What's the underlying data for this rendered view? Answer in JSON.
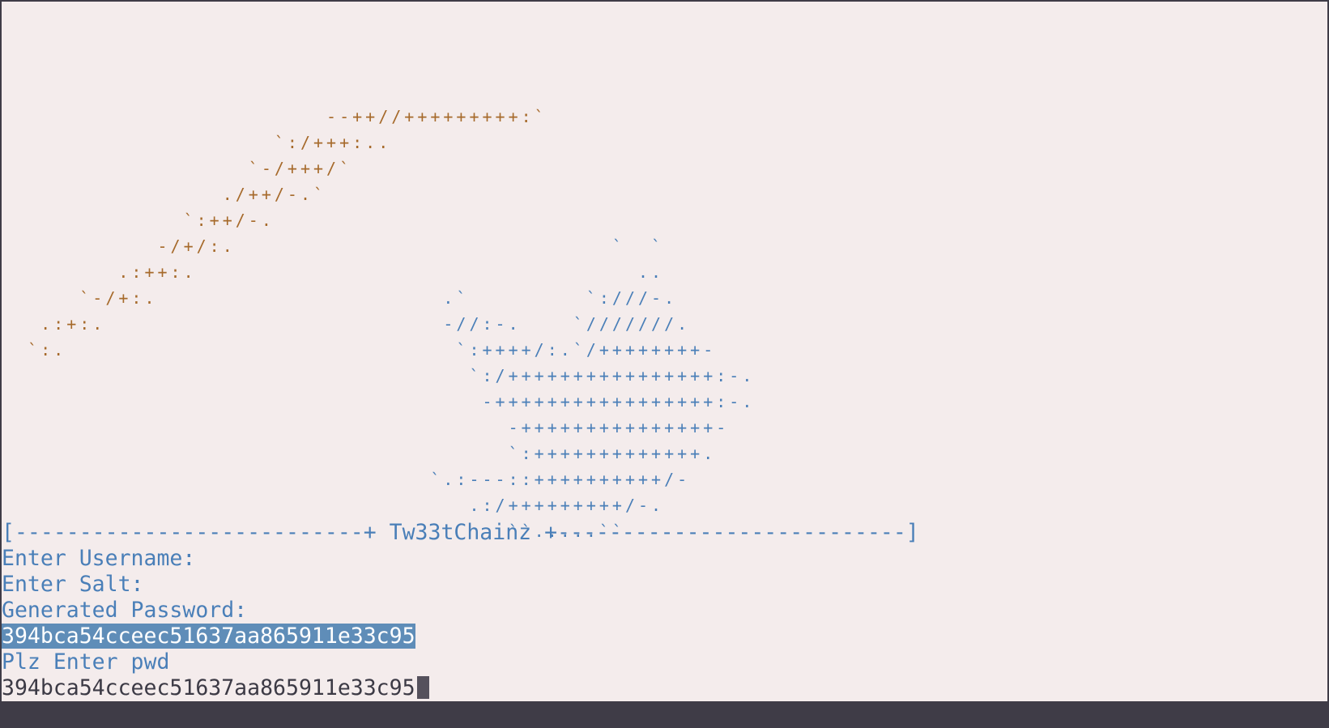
{
  "art": {
    "orange_lines": [
      "                         --++//+++++++++:`",
      "                     `:/+++:..",
      "                   `-/+++/`",
      "                 ./++/-.`",
      "              `:++/-.",
      "            -/+/:.",
      "         .:++:.",
      "      `-/+:.",
      "   .:+:.",
      "  `:."
    ],
    "blue_lines": [
      "                                               `  `",
      "                                                 ..",
      "                                  .`         `:///-.",
      "                                  -//:-.    `///////.",
      "                                   `:++++/:.`/++++++++-",
      "                                    `:/++++++++++++++++:-.",
      "                                     -+++++++++++++++++:-.",
      "                                       -+++++++++++++++-",
      "                                       `:+++++++++++++.",
      "                                 `.:---::++++++++++/-",
      "                                    .:/+++++++++/-.",
      "                                       ``.....``"
    ]
  },
  "console": {
    "banner": "[---------------------------+ Tw33tChainz +---------------------------]",
    "username_prompt": "Enter Username:",
    "salt_prompt": "Enter Salt:",
    "generated_label": "Generated Password:",
    "generated_password": "394bca54cceec51637aa865911e33c95",
    "pwd_prompt": "Plz Enter pwd",
    "pwd_input": "394bca54cceec51637aa865911e33c95"
  },
  "colors": {
    "background": "#f4ecec",
    "frame": "#3f3c47",
    "orange_art": "#a66a2b",
    "blue_text": "#4a7fb8",
    "selection": "#5f8db8"
  }
}
